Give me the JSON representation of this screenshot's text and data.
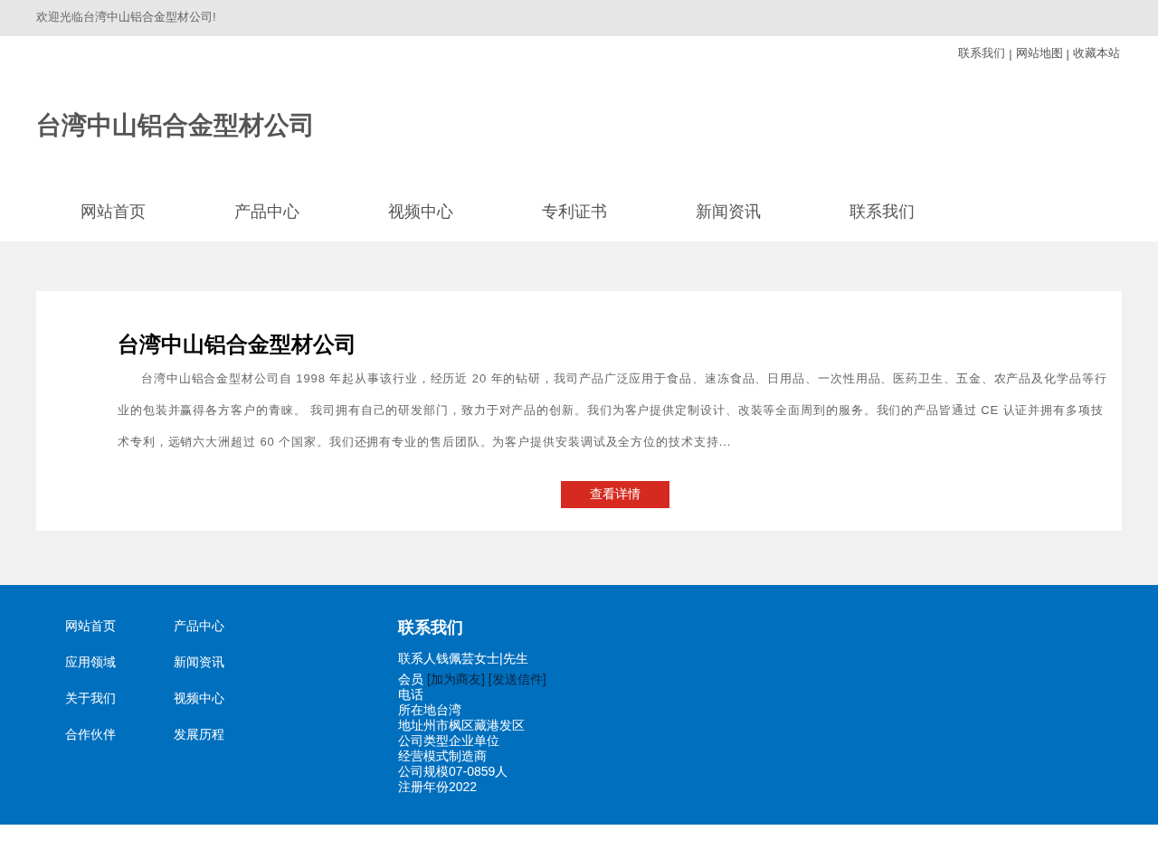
{
  "top_bar": {
    "welcome": "欢迎光临台湾中山铝合金型材公司!"
  },
  "header": {
    "top_links": [
      "联系我们",
      "网站地图",
      "收藏本站"
    ],
    "separators": [
      "|",
      "|"
    ],
    "logo_text": "台湾中山铝合金型材公司"
  },
  "nav": {
    "items": [
      "网站首页",
      "产品中心",
      "视频中心",
      "专利证书",
      "新闻资讯",
      "联系我们"
    ]
  },
  "intro": {
    "title": "台湾中山铝合金型材公司",
    "paragraph": "台湾中山铝合金型材公司自 1998 年起从事该行业，经历近 20 年的钻研，我司产品广泛应用于食品、速冻食品、日用品、一次性用品、医药卫生、五金、农产品及化学品等行业的包装并赢得各方客户的青睐。 我司拥有自己的研发部门，致力于对产品的创新。我们为客户提供定制设计、改装等全面周到的服务。我们的产品皆通过 CE 认证并拥有多项技术专利，远销六大洲超过 60 个国家。我们还拥有专业的售后团队。为客户提供安装调试及全方位的技术支持...",
    "button": "查看详情"
  },
  "footer": {
    "links": [
      "网站首页",
      "产品中心",
      "应用领域",
      "新闻资讯",
      "关于我们",
      "视频中心",
      "合作伙伴",
      "发展历程"
    ],
    "contact": {
      "title": "联系我们",
      "contact_person": "联系人钱佩芸女士|先生",
      "member": {
        "label": "会员",
        "links": [
          "[加为商友]",
          "[发送信件]"
        ]
      },
      "lines": [
        "电话",
        "所在地台湾",
        "地址州市枫区藏港发区",
        "公司类型企业单位",
        "经营模式制造商",
        "公司规模07-0859人",
        "注册年份2022"
      ]
    }
  }
}
